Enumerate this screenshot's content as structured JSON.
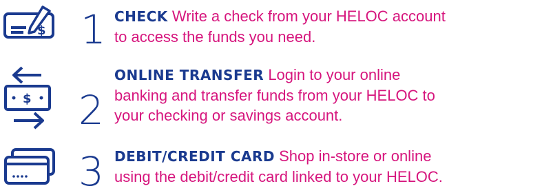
{
  "colors": {
    "navy": "#1a3a8f",
    "magenta": "#d6157d"
  },
  "steps": [
    {
      "number": "1",
      "icon": "check-writing-icon",
      "heading": "CHECK",
      "line1": "Write a check from your HELOC account",
      "line2": "to access the funds you need."
    },
    {
      "number": "2",
      "icon": "money-transfer-icon",
      "heading": "ONLINE TRANSFER",
      "line1": "Login to your online",
      "line2": "banking and transfer funds from your HELOC to",
      "line3": "your checking or savings account."
    },
    {
      "number": "3",
      "icon": "credit-cards-icon",
      "heading": "DEBIT/CREDIT CARD",
      "line1": "Shop in-store or online",
      "line2": "using the debit/credit card linked to your HELOC."
    }
  ]
}
